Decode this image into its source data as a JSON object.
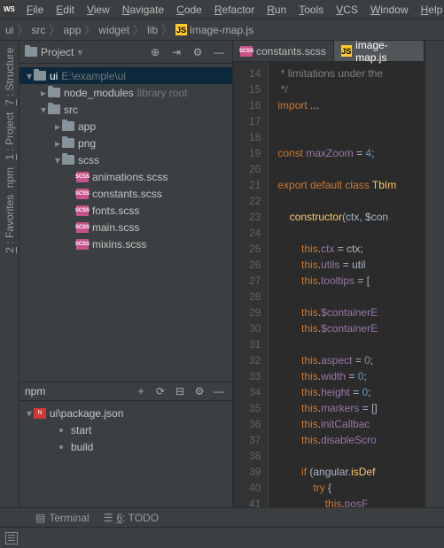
{
  "menu": [
    "File",
    "Edit",
    "View",
    "Navigate",
    "Code",
    "Refactor",
    "Run",
    "Tools",
    "VCS",
    "Window",
    "Help"
  ],
  "breadcrumbs": [
    "ui",
    "src",
    "app",
    "widget",
    "lib"
  ],
  "breadcrumb_file": "image-map.js",
  "left_tabs": [
    {
      "num": "7",
      "label": "Structure"
    },
    {
      "num": "1",
      "label": "Project"
    },
    {
      "num": "",
      "label": "npm"
    },
    {
      "num": "2",
      "label": "Favorites"
    }
  ],
  "project": {
    "title": "Project",
    "tree": [
      {
        "d": 0,
        "a": "▾",
        "t": "folder",
        "lbl": "ui",
        "hint": "E:\\example\\ui",
        "sel": true
      },
      {
        "d": 1,
        "a": "▸",
        "t": "folder",
        "lbl": "node_modules",
        "hint": "library root"
      },
      {
        "d": 1,
        "a": "▾",
        "t": "folder",
        "lbl": "src"
      },
      {
        "d": 2,
        "a": "▸",
        "t": "folder",
        "lbl": "app"
      },
      {
        "d": 2,
        "a": "▸",
        "t": "folder",
        "lbl": "png"
      },
      {
        "d": 2,
        "a": "▾",
        "t": "folder",
        "lbl": "scss"
      },
      {
        "d": 3,
        "a": "",
        "t": "scss",
        "lbl": "animations.scss"
      },
      {
        "d": 3,
        "a": "",
        "t": "scss",
        "lbl": "constants.scss"
      },
      {
        "d": 3,
        "a": "",
        "t": "scss",
        "lbl": "fonts.scss"
      },
      {
        "d": 3,
        "a": "",
        "t": "scss",
        "lbl": "main.scss"
      },
      {
        "d": 3,
        "a": "",
        "t": "scss",
        "lbl": "mixins.scss"
      }
    ]
  },
  "npm": {
    "title": "npm",
    "pkg": "ui\\package.json",
    "scripts": [
      "start",
      "build"
    ]
  },
  "tabs": [
    {
      "icon": "scss",
      "label": "constants.scss",
      "active": false
    },
    {
      "icon": "js",
      "label": "image-map.js",
      "active": true
    }
  ],
  "code": {
    "start": 14,
    "lines": [
      {
        "html": "<span class='c-cm'> * limitations under the</span>"
      },
      {
        "html": "<span class='c-cm'> */</span>"
      },
      {
        "html": "<span class='c-kw'>import</span> ..."
      },
      {
        "html": ""
      },
      {
        "html": ""
      },
      {
        "html": "<span class='c-kw'>const</span> <span class='c-id'>maxZoom</span> = <span class='c-num'>4</span>;"
      },
      {
        "html": ""
      },
      {
        "html": "<span class='c-kw'>export default class</span> <span class='c-fn'>TbIm</span>"
      },
      {
        "html": ""
      },
      {
        "html": "    <span class='c-fn'>constructor</span>(ctx, $con"
      },
      {
        "html": ""
      },
      {
        "html": "        <span class='c-kw'>this</span>.<span class='c-id'>ctx</span> = ctx;"
      },
      {
        "html": "        <span class='c-kw'>this</span>.<span class='c-id'>utils</span> = util"
      },
      {
        "html": "        <span class='c-kw'>this</span>.<span class='c-id'>tooltips</span> = ["
      },
      {
        "html": ""
      },
      {
        "html": "        <span class='c-kw'>this</span>.<span class='c-id'>$containerE</span>"
      },
      {
        "html": "        <span class='c-kw'>this</span>.<span class='c-id'>$containerE</span>"
      },
      {
        "html": ""
      },
      {
        "html": "        <span class='c-kw'>this</span>.<span class='c-id'>aspect</span> = <span class='c-num'>0</span>;"
      },
      {
        "html": "        <span class='c-kw'>this</span>.<span class='c-id'>width</span> = <span class='c-num'>0</span>;"
      },
      {
        "html": "        <span class='c-kw'>this</span>.<span class='c-id'>height</span> = <span class='c-num'>0</span>;"
      },
      {
        "html": "        <span class='c-kw'>this</span>.<span class='c-id'>markers</span> = []"
      },
      {
        "html": "        <span class='c-kw'>this</span>.<span class='c-id'>initCallbac</span>"
      },
      {
        "html": "        <span class='c-kw'>this</span>.<span class='c-id'>disableScro</span>"
      },
      {
        "html": ""
      },
      {
        "html": "        <span class='c-kw'>if</span> (angular.<span class='c-fn'>isDef</span>"
      },
      {
        "html": "            <span class='c-kw'>try</span> {"
      },
      {
        "html": "                <span class='c-kw'>this</span>.<span class='c-id'>posF</span>"
      }
    ]
  },
  "status": {
    "terminal": "Terminal",
    "todo_num": "6",
    "todo": "TODO"
  }
}
